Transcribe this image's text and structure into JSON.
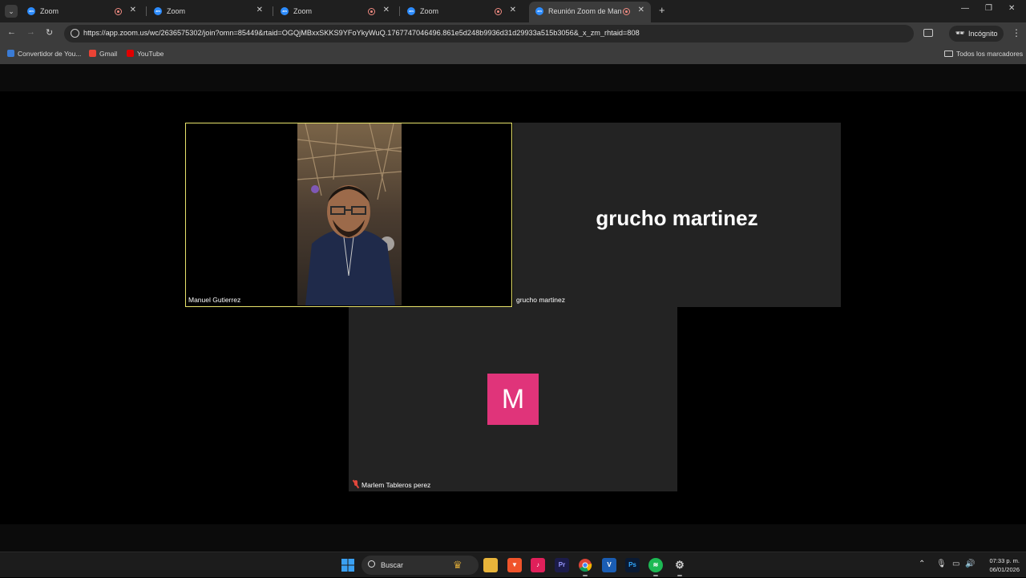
{
  "tabs": [
    {
      "title": "Zoom",
      "recording": true,
      "favicon": "zm"
    },
    {
      "title": "Zoom",
      "recording": false,
      "favicon": "zm"
    },
    {
      "title": "Zoom",
      "recording": true,
      "favicon": "zm"
    },
    {
      "title": "Zoom",
      "recording": true,
      "favicon": "zm"
    },
    {
      "title": "Reunión Zoom de Manuel Gutierrez",
      "recording": true,
      "favicon": "zm",
      "active": true
    }
  ],
  "toolbar": {
    "url": "https://app.zoom.us/wc/2636575302/join?omn=85449&rtaid=OGQjMBxxSKKS9YFoYkyWuQ.1767747046496.861e5d248b9936d31d29933a515b3056&_x_zm_rhtaid=808",
    "incognito_label": "Incógnito"
  },
  "bookmarks": {
    "items": [
      {
        "label": "Convertidor de You...",
        "color": "#3a7bd5"
      },
      {
        "label": "Gmail",
        "color": "#ea4335"
      },
      {
        "label": "YouTube",
        "color": "#e00000"
      }
    ],
    "all_label": "Todos los marcadores"
  },
  "meeting": {
    "active_speaker_border": "#e8e36b",
    "participants": [
      {
        "name": "Manuel Gutierrez",
        "video": true
      },
      {
        "name": "grucho martinez",
        "big_label": "grucho martinez",
        "video": false
      },
      {
        "name": "Marlem Tableros perez",
        "initial": "M",
        "avatar_color": "#e0347a",
        "muted": true
      }
    ]
  },
  "taskbar": {
    "search_label": "Buscar",
    "pinned": [
      "windows-icon",
      "search",
      "file-explorer-icon",
      "brave-icon",
      "tiktok-icon",
      "premiere-icon",
      "chrome-icon",
      "visio-icon",
      "photoshop-icon",
      "spotify-icon",
      "settings-icon"
    ],
    "time": "07:33 p. m.",
    "date": "06/01/2026"
  }
}
